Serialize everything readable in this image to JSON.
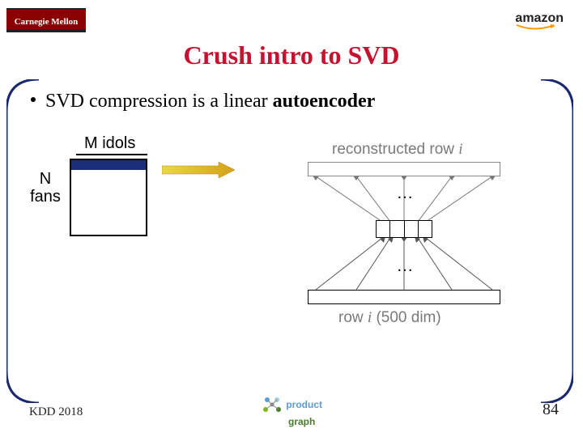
{
  "logos": {
    "cmu_text": "Carnegie Mellon",
    "amazon_text": "amazon"
  },
  "title": "Crush intro to SVD",
  "bullet": {
    "prefix": "SVD compression is a linear ",
    "bold": "autoencoder"
  },
  "diagram": {
    "cols_label": "M idols",
    "rows_label_1": "N",
    "rows_label_2": "fans",
    "recon_prefix": "reconstructed row ",
    "recon_var": "i",
    "dots": "…",
    "rowi_prefix": "row ",
    "rowi_var": "i",
    "rowi_dim": " (500 dim)"
  },
  "footer": {
    "venue": "KDD 2018",
    "product": "product",
    "graph": "graph",
    "page": "84"
  }
}
